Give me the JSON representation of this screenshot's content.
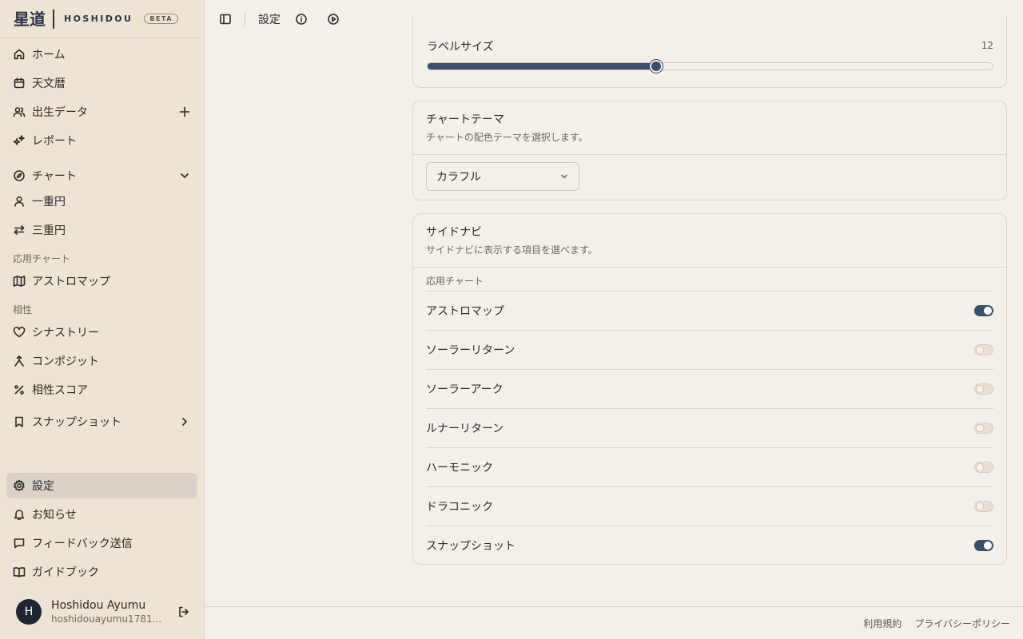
{
  "brand": {
    "kanji": "星道",
    "name": "HOSHIDOU",
    "badge": "BETA"
  },
  "sidebar": {
    "items": [
      {
        "label": "ホーム",
        "icon": "home-icon"
      },
      {
        "label": "天文暦",
        "icon": "calendar-icon"
      },
      {
        "label": "出生データ",
        "icon": "users-icon",
        "action": "plus-icon"
      },
      {
        "label": "レポート",
        "icon": "sparkles-icon"
      },
      {
        "label": "チャート",
        "icon": "compass-icon",
        "action": "chevron-down-icon"
      },
      {
        "label": "一重円",
        "icon": "user-icon"
      },
      {
        "label": "三重円",
        "icon": "arrows-icon"
      },
      {
        "label": "アストロマップ",
        "icon": "map-icon"
      },
      {
        "label": "シナストリー",
        "icon": "heart-icon"
      },
      {
        "label": "コンポジット",
        "icon": "merge-icon"
      },
      {
        "label": "相性スコア",
        "icon": "percent-icon"
      },
      {
        "label": "スナップショット",
        "icon": "bookmark-icon",
        "action": "chevron-right-icon"
      },
      {
        "label": "設定",
        "icon": "gear-icon"
      },
      {
        "label": "お知らせ",
        "icon": "bell-icon"
      },
      {
        "label": "フィードバック送信",
        "icon": "message-icon"
      },
      {
        "label": "ガイドブック",
        "icon": "book-icon"
      }
    ],
    "sections": {
      "applied": "応用チャート",
      "compat": "相性"
    },
    "active": "設定"
  },
  "user": {
    "initial": "H",
    "name": "Hoshidou Ayumu",
    "email": "hoshidouayumu1781..."
  },
  "header": {
    "title": "設定"
  },
  "label_size": {
    "label": "ラベルサイズ",
    "value": "12",
    "fraction": 0.404
  },
  "chart_theme": {
    "title": "チャートテーマ",
    "desc": "チャートの配色テーマを選択します。",
    "selected": "カラフル"
  },
  "side_nav": {
    "title": "サイドナビ",
    "desc": "サイドナビに表示する項目を選べます。",
    "group": "応用チャート",
    "options": [
      {
        "label": "アストロマップ",
        "on": true
      },
      {
        "label": "ソーラーリターン",
        "on": false
      },
      {
        "label": "ソーラーアーク",
        "on": false
      },
      {
        "label": "ルナーリターン",
        "on": false
      },
      {
        "label": "ハーモニック",
        "on": false
      },
      {
        "label": "ドラコニック",
        "on": false
      },
      {
        "label": "スナップショット",
        "on": true
      }
    ]
  },
  "footer": {
    "terms": "利用規約",
    "privacy": "プライバシーポリシー"
  },
  "colors": {
    "accent": "#3a4f6b",
    "sidebar_bg": "#ede4d4",
    "page_bg": "#f4f0e9"
  }
}
